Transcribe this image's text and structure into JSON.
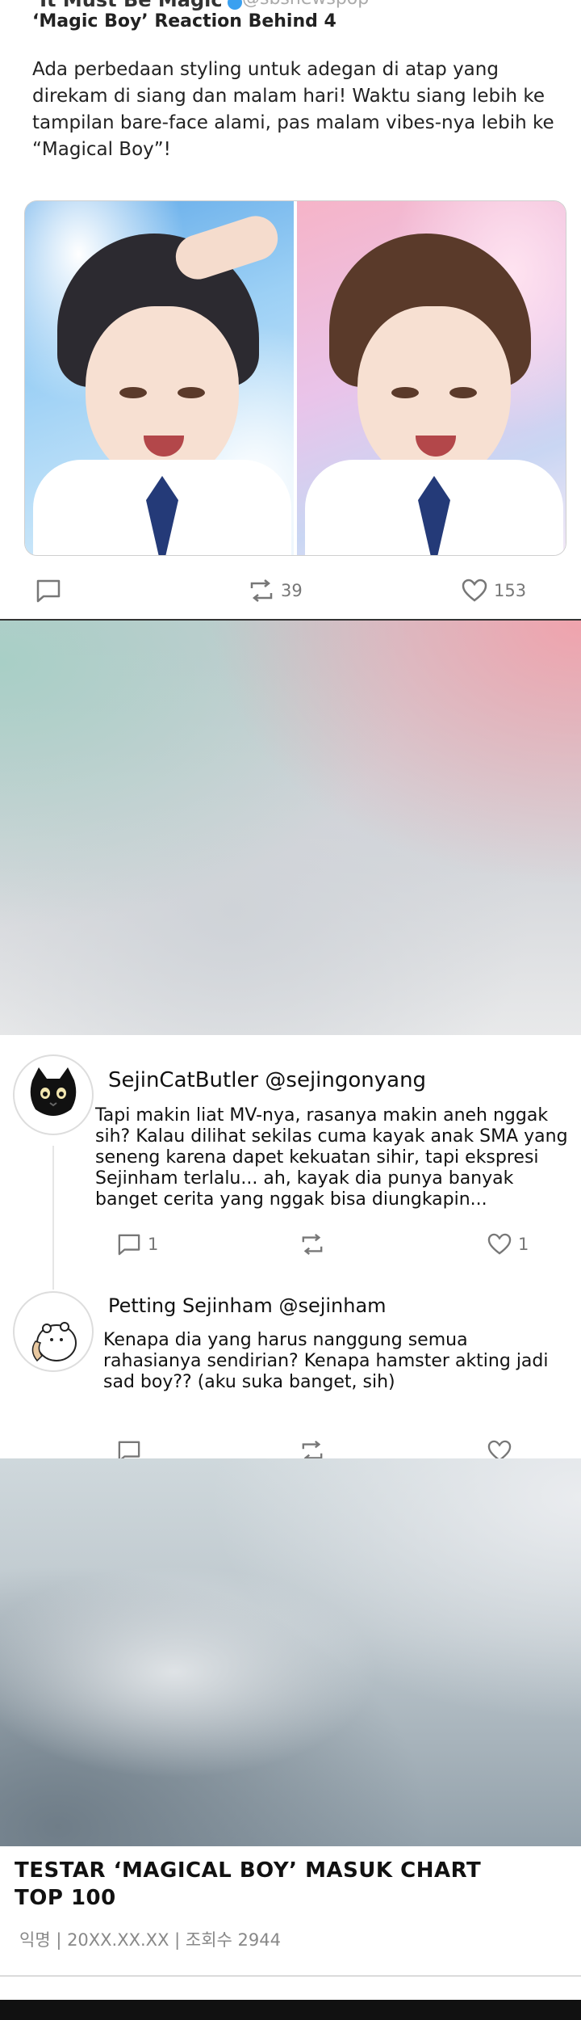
{
  "tweet1": {
    "partial_title": "‘It Must Be Magic’",
    "partial_handle": "@sbsnewspop",
    "title": "‘Magic Boy’ Reaction Behind 4",
    "body": "Ada perbedaan styling untuk adegan di atap yang direkam di siang dan malam hari! Waktu siang lebih ke tampilan bare-face alami, pas malam vibes-nya lebih ke “Magical Boy”!",
    "retweets": "39",
    "likes": "153"
  },
  "reply1": {
    "name": "SejinCatButler",
    "handle": "@sejingonyang",
    "text": "Tapi makin liat MV-nya, rasanya makin aneh nggak sih? Kalau dilihat sekilas cuma kayak anak SMA yang seneng karena dapet kekuatan sihir, tapi ekspresi Sejinham terlalu... ah, kayak dia punya banyak banget cerita yang nggak bisa diungkapin...",
    "replies": "1",
    "likes": "1"
  },
  "reply2": {
    "name": "Petting Sejinham",
    "handle": "@sejinham",
    "text": "Kenapa dia yang harus nanggung semua rahasianya sendirian? Kenapa hamster akting jadi sad boy?? (aku suka banget, sih)"
  },
  "article": {
    "title": "TESTAR ‘MAGICAL BOY’ MASUK CHART TOP 100",
    "meta": "익명 | 20XX.XX.XX | 조회수 2944"
  },
  "colors": {
    "accent_blue": "#3aa0f0",
    "icon_gray": "#777777"
  }
}
